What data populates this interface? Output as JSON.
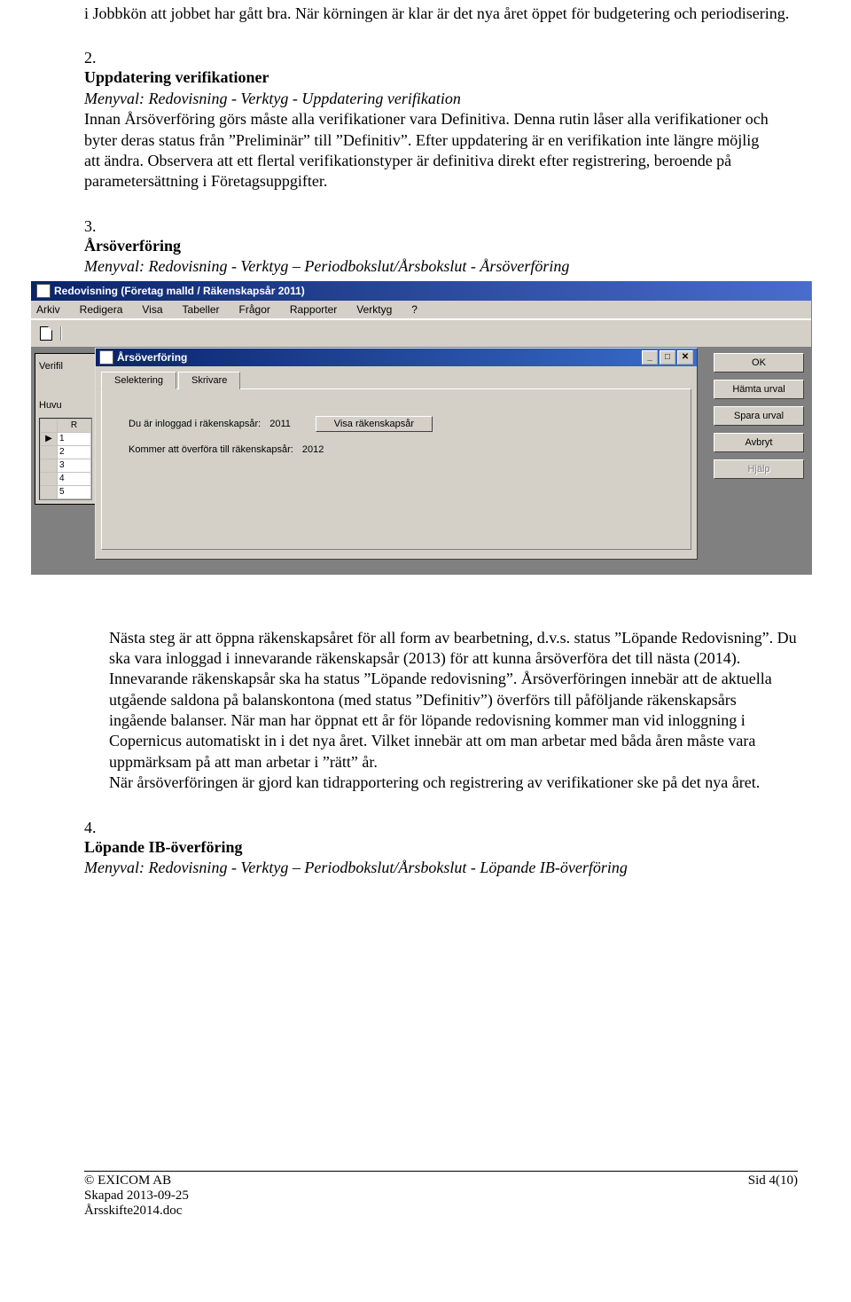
{
  "intro": "i Jobbkön att jobbet har gått bra. När körningen är klar är det nya året öppet för budgetering och periodisering.",
  "item2": {
    "num": "2.",
    "title": "Uppdatering verifikationer",
    "menyval": "Menyval: Redovisning - Verktyg - Uppdatering verifikation",
    "body": "Innan Årsöverföring görs måste alla verifikationer vara Definitiva. Denna rutin låser alla verifikationer och byter deras status från ”Preliminär” till ”Definitiv”. Efter uppdatering är en verifikation inte längre möjlig att ändra. Observera att ett flertal verifikationstyper är definitiva direkt efter registrering, beroende på parametersättning i Företagsuppgifter."
  },
  "item3": {
    "num": "3.",
    "title": "Årsöverföring",
    "menyval": "Menyval: Redovisning - Verktyg – Periodbokslut/Årsbokslut - Årsöverföring"
  },
  "app": {
    "title": "Redovisning (Företag malld / Räkenskapsår 2011)",
    "menu": [
      "Arkiv",
      "Redigera",
      "Visa",
      "Tabeller",
      "Frågor",
      "Rapporter",
      "Verktyg",
      "?"
    ],
    "back_label1": "Verifil",
    "back_label2": "Huvu",
    "grid_header": "R",
    "grid_rows": [
      "1",
      "2",
      "3",
      "4",
      "5"
    ],
    "innerwin_title": "Årsöverföring",
    "tabs": {
      "t1": "Selektering",
      "t2": "Skrivare"
    },
    "row1_label": "Du är inloggad i räkenskapsår:",
    "row1_value": "2011",
    "row1_btn": "Visa räkenskapsår",
    "row2_label": "Kommer att överföra till räkenskapsår:",
    "row2_value": "2012",
    "btns": {
      "ok": "OK",
      "hamta": "Hämta urval",
      "spara": "Spara urval",
      "avbryt": "Avbryt",
      "hjalp": "Hjälp"
    }
  },
  "after1": "Nästa steg är att öppna räkenskapsåret för all form av bearbetning, d.v.s. status ”Löpande Redovisning”. Du ska vara inloggad i innevarande räkenskapsår (2013) för att kunna årsöverföra det till nästa (2014). Innevarande räkenskapsår ska ha status ”Löpande redovisning”. Årsöverföringen innebär att de aktuella utgående saldona på balanskontona (med status ”Definitiv”) överförs till påföljande räkenskapsårs ingående balanser. När man har öppnat ett år för löpande redovisning kommer man vid inloggning i Copernicus automatiskt in i det nya året. Vilket innebär att om man arbetar med båda åren måste vara uppmärksam på att man arbetar i ”rätt” år.",
  "after2": "När årsöverföringen är gjord kan tidrapportering och registrering av verifikationer ske på det nya året.",
  "item4": {
    "num": "4.",
    "title": "Löpande IB-överföring",
    "menyval": "Menyval: Redovisning - Verktyg – Periodbokslut/Årsbokslut - Löpande IB-överföring"
  },
  "footer": {
    "copyright": "© EXICOM AB",
    "skapad": "Skapad 2013-09-25",
    "file": "Årsskifte2014.doc",
    "page": "Sid 4(10)"
  }
}
